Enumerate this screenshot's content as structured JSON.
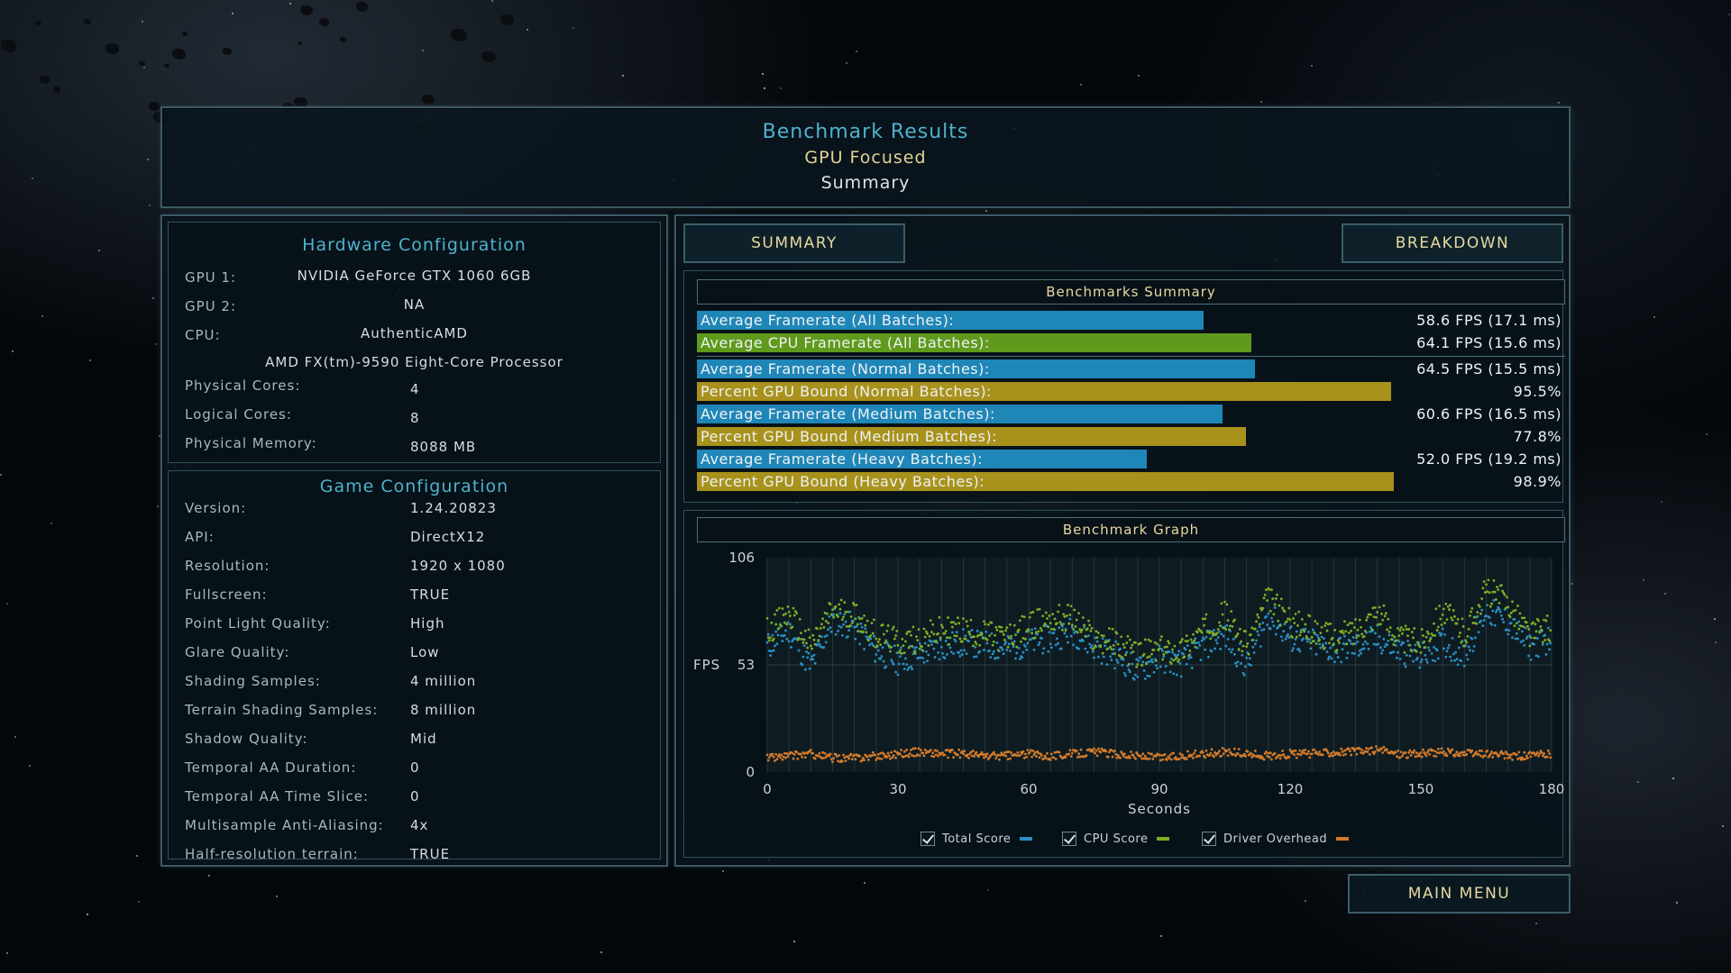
{
  "header": {
    "title": "Benchmark Results",
    "subtitle": "GPU Focused",
    "mode": "Summary"
  },
  "hardware": {
    "title": "Hardware Configuration",
    "gpu1_label": "GPU 1:",
    "gpu1_value": "NVIDIA GeForce GTX 1060 6GB",
    "gpu2_label": "GPU 2:",
    "gpu2_value": "NA",
    "cpu_label": "CPU:",
    "cpu_value": "AuthenticAMD",
    "cpu_model": "AMD FX(tm)-9590 Eight-Core Processor",
    "physical_cores_label": "Physical Cores:",
    "physical_cores_value": "4",
    "logical_cores_label": "Logical Cores:",
    "logical_cores_value": "8",
    "memory_label": "Physical Memory:",
    "memory_value": "8088  MB"
  },
  "game": {
    "title": "Game Configuration",
    "rows": [
      {
        "label": "Version:",
        "value": "1.24.20823"
      },
      {
        "label": "API:",
        "value": "DirectX12"
      },
      {
        "label": "Resolution:",
        "value": "1920 x 1080"
      },
      {
        "label": "Fullscreen:",
        "value": "TRUE"
      },
      {
        "label": "Point Light Quality:",
        "value": "High"
      },
      {
        "label": "Glare Quality:",
        "value": "Low"
      },
      {
        "label": "Shading Samples:",
        "value": "4 million"
      },
      {
        "label": "Terrain Shading Samples:",
        "value": "8 million"
      },
      {
        "label": "Shadow Quality:",
        "value": "Mid"
      },
      {
        "label": "Temporal AA Duration:",
        "value": "0"
      },
      {
        "label": "Temporal AA Time Slice:",
        "value": "0"
      },
      {
        "label": "Multisample Anti-Aliasing:",
        "value": "4x"
      },
      {
        "label": "Half-resolution terrain:",
        "value": "TRUE"
      }
    ]
  },
  "tabs": {
    "summary": "SUMMARY",
    "breakdown": "BREAKDOWN"
  },
  "summary": {
    "title": "Benchmarks Summary",
    "rows": [
      {
        "label": "Average Framerate (All Batches):",
        "value": "58.6 FPS (17.1 ms)",
        "fraction": 0.584,
        "color": "#1f86b8"
      },
      {
        "label": "Average CPU Framerate (All Batches):",
        "value": "64.1 FPS (15.6 ms)",
        "fraction": 0.639,
        "color": "#5f9a1c"
      },
      {
        "label": "Average Framerate (Normal Batches):",
        "value": "64.5 FPS (15.5 ms)",
        "fraction": 0.643,
        "color": "#1f86b8"
      },
      {
        "label": "Percent GPU Bound (Normal Batches):",
        "value": "95.5%",
        "fraction": 0.8,
        "color": "#a8921c"
      },
      {
        "label": "Average Framerate (Medium Batches):",
        "value": "60.6 FPS (16.5 ms)",
        "fraction": 0.605,
        "color": "#1f86b8"
      },
      {
        "label": "Percent GPU Bound (Medium Batches):",
        "value": "77.8%",
        "fraction": 0.632,
        "color": "#a8921c"
      },
      {
        "label": "Average Framerate (Heavy Batches):",
        "value": "52.0 FPS (19.2 ms)",
        "fraction": 0.518,
        "color": "#1f86b8"
      },
      {
        "label": "Percent GPU Bound (Heavy Batches):",
        "value": "98.9%",
        "fraction": 0.803,
        "color": "#a8921c"
      }
    ]
  },
  "graph_title": "Benchmark Graph",
  "chart_data": {
    "type": "scatter",
    "xlabel": "Seconds",
    "ylabel": "FPS",
    "xlim": [
      0,
      180
    ],
    "ylim": [
      0,
      106
    ],
    "xticks": [
      "0",
      "30",
      "60",
      "90",
      "120",
      "150",
      "180"
    ],
    "yticks": [
      "106",
      "53",
      "0"
    ],
    "grid": true,
    "series": [
      {
        "name": "Total Score",
        "color": "#2a8fc4",
        "x": [
          0,
          5,
          10,
          15,
          20,
          25,
          30,
          35,
          40,
          45,
          50,
          55,
          60,
          65,
          70,
          75,
          80,
          85,
          90,
          95,
          100,
          105,
          110,
          115,
          120,
          125,
          130,
          135,
          140,
          145,
          150,
          155,
          160,
          165,
          170,
          175,
          180
        ],
        "y": [
          62,
          70,
          52,
          75,
          72,
          60,
          55,
          58,
          62,
          64,
          63,
          61,
          64,
          66,
          70,
          62,
          58,
          50,
          56,
          54,
          62,
          68,
          52,
          78,
          66,
          64,
          60,
          62,
          66,
          60,
          57,
          64,
          58,
          80,
          74,
          62,
          66
        ]
      },
      {
        "name": "CPU Score",
        "color": "#7fae24",
        "x": [
          0,
          5,
          10,
          15,
          20,
          25,
          30,
          35,
          40,
          45,
          50,
          55,
          60,
          65,
          70,
          75,
          80,
          85,
          90,
          95,
          100,
          105,
          110,
          115,
          120,
          125,
          130,
          135,
          140,
          145,
          150,
          155,
          160,
          165,
          170,
          175,
          180
        ],
        "y": [
          70,
          78,
          62,
          80,
          78,
          68,
          64,
          66,
          70,
          70,
          68,
          66,
          72,
          76,
          76,
          66,
          64,
          58,
          60,
          60,
          70,
          78,
          62,
          86,
          74,
          70,
          66,
          70,
          80,
          66,
          64,
          80,
          68,
          90,
          84,
          68,
          72
        ]
      },
      {
        "name": "Driver Overhead",
        "color": "#d27a2a",
        "x": [
          0,
          5,
          10,
          15,
          20,
          25,
          30,
          35,
          40,
          45,
          50,
          55,
          60,
          65,
          70,
          75,
          80,
          85,
          90,
          95,
          100,
          105,
          110,
          115,
          120,
          125,
          130,
          135,
          140,
          145,
          150,
          155,
          160,
          165,
          170,
          175,
          180
        ],
        "y": [
          7,
          8,
          9,
          7,
          7,
          8,
          9,
          10,
          9,
          9,
          8,
          8,
          9,
          8,
          9,
          10,
          9,
          8,
          7,
          8,
          9,
          10,
          9,
          8,
          9,
          9,
          10,
          10,
          11,
          9,
          9,
          10,
          9,
          9,
          8,
          8,
          9
        ]
      }
    ]
  },
  "legend": {
    "total": "Total Score",
    "cpu": "CPU Score",
    "driver": "Driver Overhead"
  },
  "main_menu": "MAIN MENU"
}
